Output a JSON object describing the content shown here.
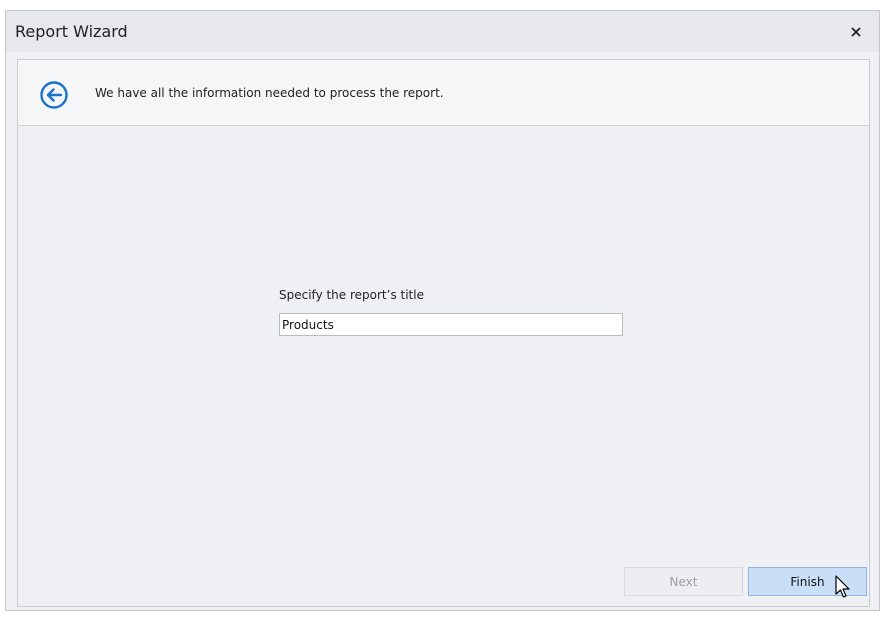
{
  "window": {
    "title": "Report Wizard",
    "close_icon": "close-icon"
  },
  "header": {
    "back_icon": "back-arrow-icon",
    "message": "We have all the information needed to process the report."
  },
  "form": {
    "title_label": "Specify the report’s title",
    "title_value": "Products"
  },
  "footer": {
    "next_label": "Next",
    "next_enabled": false,
    "finish_label": "Finish"
  },
  "colors": {
    "accent": "#1a73c9",
    "finish_bg": "#c9dff7",
    "window_bg": "#eef0f3"
  }
}
